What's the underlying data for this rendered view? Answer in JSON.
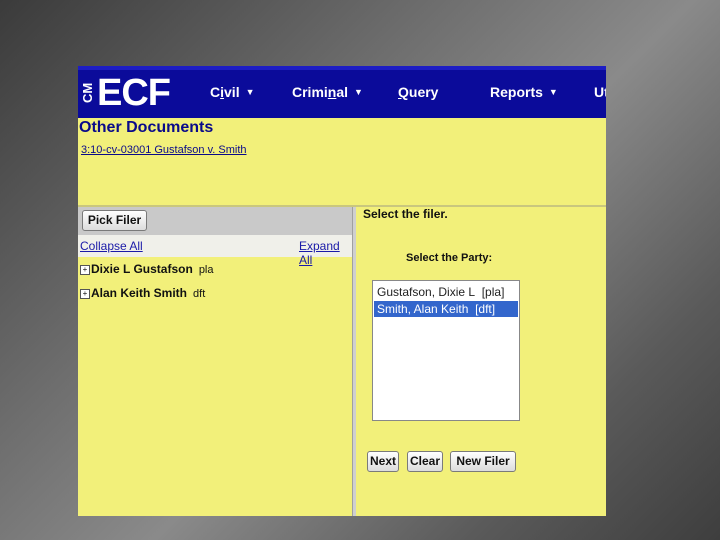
{
  "app": {
    "logo_prefix": "CM",
    "logo_text": "ECF"
  },
  "menu": [
    {
      "label": "Civil",
      "has_caret": true
    },
    {
      "label": "Criminal",
      "has_caret": true
    },
    {
      "label": "Query",
      "has_caret": false
    },
    {
      "label": "Reports",
      "has_caret": true
    },
    {
      "label": "Ut",
      "has_caret": false
    }
  ],
  "page": {
    "title": "Other Documents",
    "case_link": "3:10-cv-03001 Gustafson v. Smith"
  },
  "left_pane": {
    "pick_filer_label": "Pick Filer",
    "collapse_all": "Collapse All",
    "expand_all": "Expand All",
    "parties": [
      {
        "expander": "+",
        "name": "Dixie L Gustafson",
        "role": "pla"
      },
      {
        "expander": "+",
        "name": "Alan Keith Smith",
        "role": "dft"
      }
    ]
  },
  "right_pane": {
    "heading": "Select the filer.",
    "party_label": "Select the Party:",
    "party_options": [
      {
        "name": "Gustafson, Dixie L",
        "role": "[pla]",
        "selected": false
      },
      {
        "name": "Smith, Alan Keith",
        "role": "[dft]",
        "selected": true
      }
    ],
    "buttons": {
      "next": "Next",
      "clear": "Clear",
      "new_filer": "New Filer"
    }
  },
  "colors": {
    "page_bg": "#f2f07a",
    "nav_bg": "#0b0b9a",
    "link": "#0a0a8a",
    "selection": "#3366cc"
  }
}
